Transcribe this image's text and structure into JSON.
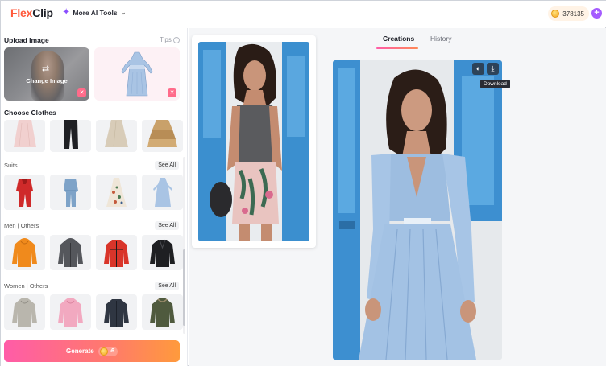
{
  "header": {
    "logo_text_a": "Flex",
    "logo_text_b": "Clip",
    "ai_menu_label": "More AI Tools",
    "credits": "378135"
  },
  "left_panel": {
    "upload_title": "Upload Image",
    "tips_label": "Tips",
    "change_image_label": "Change Image",
    "choose_title": "Choose Clothes",
    "sections": [
      {
        "label": "Suits",
        "see_all": "See All"
      },
      {
        "label": "Men | Others",
        "see_all": "See All"
      },
      {
        "label": "Women | Others",
        "see_all": "See All"
      }
    ],
    "generate_label": "Generate",
    "generate_cost": "-6"
  },
  "workspace": {
    "tabs": [
      {
        "label": "Creations",
        "active": true
      },
      {
        "label": "History",
        "active": false
      }
    ],
    "download_tooltip": "Download"
  },
  "colors": {
    "accent_pink": "#ff5ca8",
    "accent_orange": "#ff9a3c",
    "brand_purple": "#a55cff"
  }
}
